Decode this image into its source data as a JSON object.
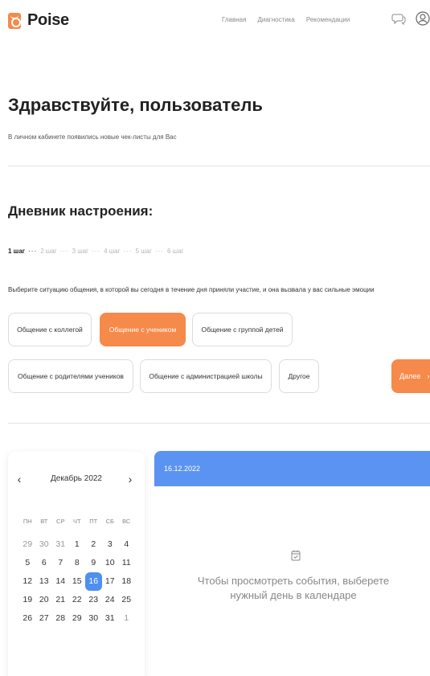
{
  "header": {
    "logo_text": "Poise",
    "nav": [
      "Главная",
      "Диагностика",
      "Рекомендации"
    ],
    "icons": [
      "chat-icon",
      "profile-icon"
    ]
  },
  "greeting": {
    "title": "Здравствуйте, пользователь",
    "subtitle": "В личном кабинете появились новые чек-листы для Вас"
  },
  "diary": {
    "title": "Дневник настроения:",
    "steps": [
      "1 шаг",
      "2 шаг",
      "3 шаг",
      "4 шаг",
      "5 шаг",
      "6 шаг"
    ],
    "step_separator": "···",
    "active_step": 1,
    "question": "Выберите ситуацию общения, в которой вы сегодня в течение дня приняли участие, и она вызвала у вас сильные эмоции",
    "options": [
      "Общение с коллегой",
      "Общение с учеником",
      "Общение с группой детей",
      "Общение с родителями учеников",
      "Общение с администрацией школы",
      "Другое"
    ],
    "selected_option": "Общение с учеником",
    "next_label": "Далее",
    "next_arrow": "›"
  },
  "calendar": {
    "prev": "‹",
    "next": "›",
    "month_label": "Декабрь 2022",
    "weekdays": [
      "ПН",
      "ВТ",
      "СР",
      "ЧТ",
      "ПТ",
      "СБ",
      "ВС"
    ],
    "days": [
      "29",
      "30",
      "31",
      "1",
      "2",
      "3",
      "4",
      "5",
      "6",
      "7",
      "8",
      "9",
      "10",
      "11",
      "12",
      "13",
      "14",
      "15",
      "16",
      "17",
      "18",
      "19",
      "20",
      "21",
      "22",
      "23",
      "24",
      "25",
      "26",
      "27",
      "28",
      "29",
      "30",
      "31",
      "1"
    ],
    "muted_indices": [
      0,
      1,
      2,
      34
    ],
    "selected_index": 18
  },
  "events": {
    "date": "16.12.2022",
    "icon": "calendar-check-icon",
    "empty_text": "Чтобы просмотреть события, выберете нужный день в календаре"
  },
  "colors": {
    "accent_orange": "#f68a4a",
    "accent_blue": "#5a93f2",
    "selected_day": "#4f8ff0"
  }
}
